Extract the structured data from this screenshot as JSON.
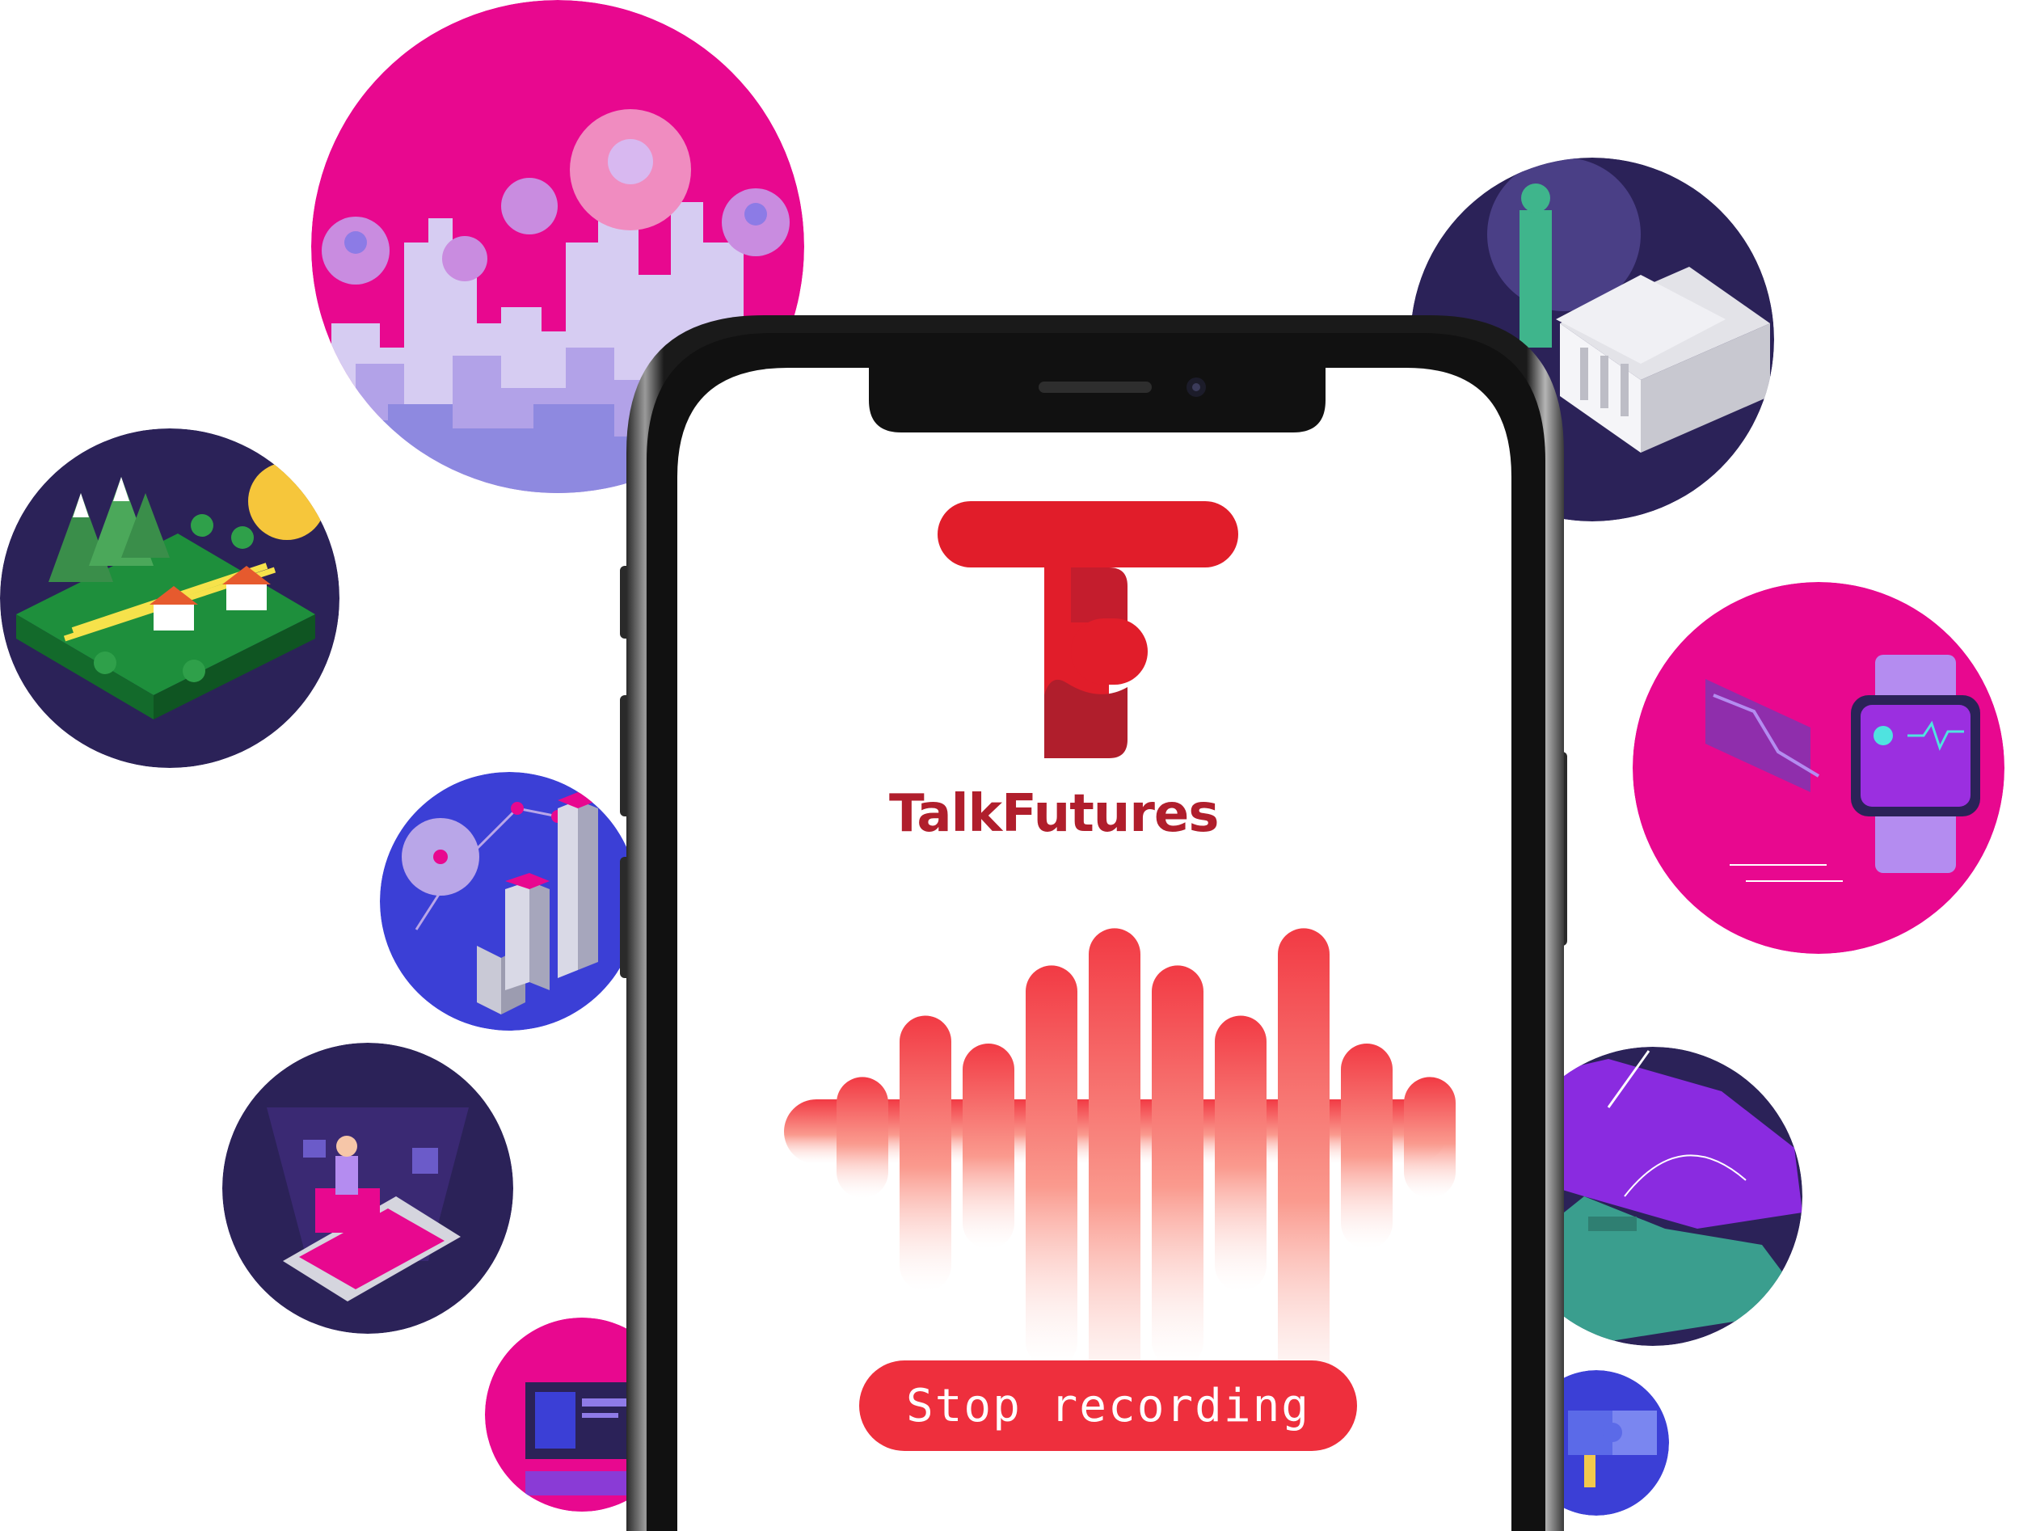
{
  "app": {
    "brand_name": "TalkFutures",
    "stop_button_label": "Stop recording"
  },
  "colors": {
    "brand_red": "#E11D2A",
    "brand_dark_red": "#B01E2C",
    "button_red": "#EE2F3D",
    "button_text": "#FFFFFF",
    "magenta": "#E8088F",
    "navy": "#2B2258",
    "indigo": "#3B3FD6",
    "phone_frame": "#111111"
  },
  "waveform": {
    "bars": [
      0.12,
      0.45,
      0.3,
      0.72,
      0.92,
      0.72,
      0.45,
      0.92,
      0.3,
      0.12
    ],
    "fill_top": "#F23A44",
    "fill_bottom": "#FFE1DD"
  },
  "illustrations": [
    {
      "id": "city-network",
      "icon": "city-people-icon"
    },
    {
      "id": "village",
      "icon": "village-icon"
    },
    {
      "id": "analytics",
      "icon": "bar-graph-icon"
    },
    {
      "id": "virtual-reality",
      "icon": "vr-user-icon"
    },
    {
      "id": "coding",
      "icon": "laptop-code-icon"
    },
    {
      "id": "justice",
      "icon": "courthouse-icon"
    },
    {
      "id": "wearable-health",
      "icon": "smartwatch-icon"
    },
    {
      "id": "conflict",
      "icon": "battlefield-icon"
    },
    {
      "id": "puzzle-team",
      "icon": "puzzle-icon"
    }
  ]
}
